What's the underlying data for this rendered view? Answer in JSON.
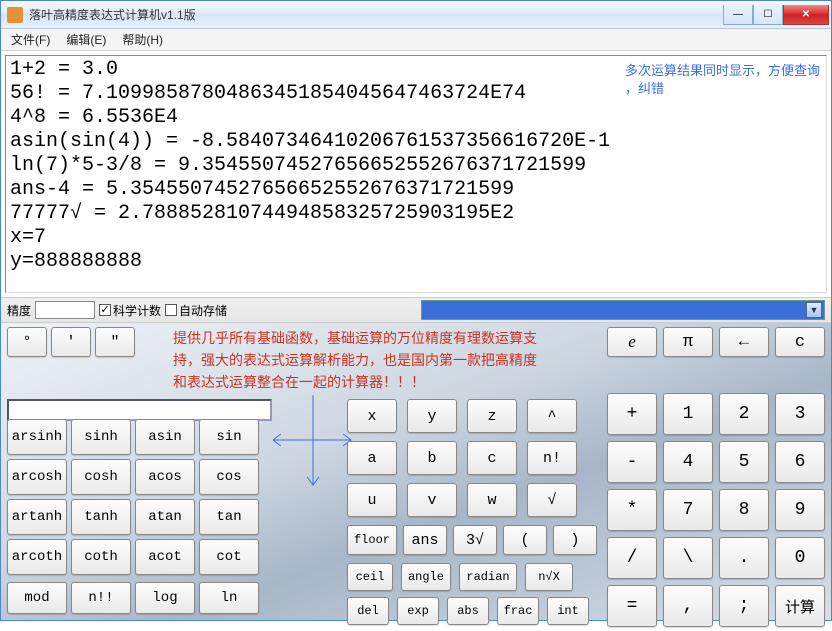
{
  "window": {
    "title": "落叶高精度表达式计算机v1.1版"
  },
  "menu": {
    "file": "文件(F)",
    "edit": "编辑(E)",
    "help": "帮助(H)"
  },
  "output_lines": [
    "1+2 = 3.0",
    "56! = 7.10998587804863451854045647463724E74",
    "4^8 = 6.5536E4",
    "asin(sin(4)) = -8.58407346410206761537356616720E-1",
    "ln(7)*5-3/8 = 9.35455074527656652552676371721599",
    "ans-4 = 5.35455074527656652552676371721599",
    "77777√ = 2.78885281074494858325725903195E2",
    "x=7",
    "y=888888888"
  ],
  "annotation_right": "多次运算结果同时显示，方便查询\n，纠错",
  "opts": {
    "precision_label": "精度",
    "sci_label": "科学计数",
    "auto_label": "自动存储",
    "sci_checked": "✓",
    "auto_checked": ""
  },
  "quote_btns": [
    "°",
    "'",
    "\""
  ],
  "annotation_panel": "提供几乎所有基础函数，基础运算的万位精度有理数运算支持，强大的表达式运算解析能力，也是国内第一款把高精度和表达式运算整合在一起的计算器！！！",
  "consts": {
    "e": "e",
    "pi": "π",
    "back": "←",
    "clear": "c"
  },
  "func_grid": [
    [
      "arsinh",
      "sinh",
      "asin",
      "sin"
    ],
    [
      "arcosh",
      "cosh",
      "acos",
      "cos"
    ],
    [
      "artanh",
      "tanh",
      "atan",
      "tan"
    ],
    [
      "arcoth",
      "coth",
      "acot",
      "cot"
    ]
  ],
  "mod_row": [
    "mod",
    "n!!",
    "log",
    "ln"
  ],
  "mid": {
    "row1": [
      "x",
      "y",
      "z",
      "^"
    ],
    "row2": [
      "a",
      "b",
      "c",
      "n!"
    ],
    "row3": [
      "u",
      "v",
      "w",
      "√"
    ],
    "row4": [
      "floor",
      "ans",
      "3√",
      "(",
      ")"
    ],
    "row5": [
      "ceil",
      "angle",
      "radian",
      "n√X"
    ],
    "row6": [
      "del",
      "exp",
      "abs",
      "frac",
      "int"
    ]
  },
  "numpad": [
    [
      "+",
      "1",
      "2",
      "3"
    ],
    [
      "-",
      "4",
      "5",
      "6"
    ],
    [
      "*",
      "7",
      "8",
      "9"
    ],
    [
      "/",
      "\\",
      ".",
      "0"
    ],
    [
      "=",
      ",",
      ";",
      "计算"
    ]
  ]
}
